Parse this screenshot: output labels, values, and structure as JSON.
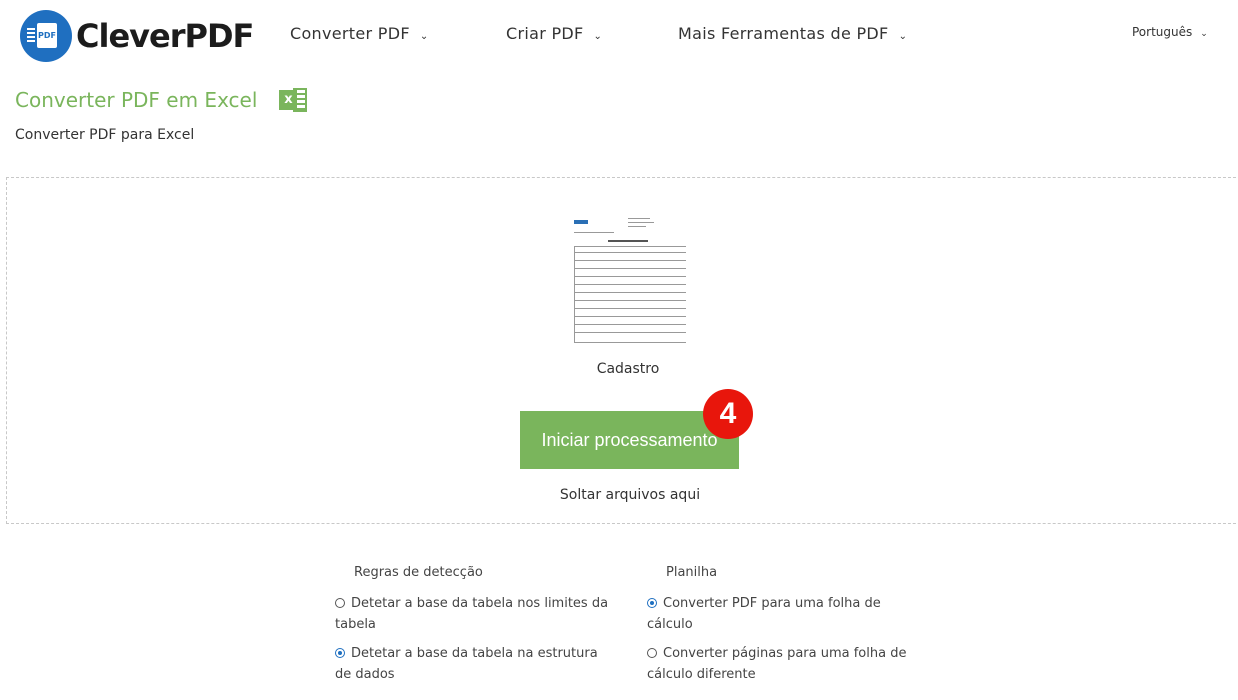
{
  "header": {
    "logo_text": "CleverPDF",
    "logo_mark_label": "PDF",
    "nav": [
      {
        "label": "Converter PDF"
      },
      {
        "label": "Criar PDF"
      },
      {
        "label": "Mais Ferramentas de PDF"
      }
    ],
    "language": "Português"
  },
  "page": {
    "title": "Converter PDF em Excel",
    "subtitle": "Converter PDF para Excel"
  },
  "upload": {
    "file_name": "Cadastro",
    "start_button": "Iniciar processamento",
    "step_badge": "4",
    "drop_hint": "Soltar arquivos aqui"
  },
  "options": {
    "detection_rules": {
      "heading": "Regras de detecção",
      "items": [
        {
          "label": "Detetar a base da tabela nos limites da tabela",
          "selected": false
        },
        {
          "label": "Detetar a base da tabela na estrutura de dados",
          "selected": true
        }
      ]
    },
    "spreadsheet": {
      "heading": "Planilha",
      "items": [
        {
          "label": "Converter PDF para uma folha de cálculo",
          "selected": true
        },
        {
          "label": "Converter páginas para uma folha de cálculo diferente",
          "selected": false
        }
      ]
    }
  },
  "colors": {
    "accent_green": "#7ab55c",
    "brand_blue": "#1f6fc0",
    "badge_red": "#e8160c"
  }
}
